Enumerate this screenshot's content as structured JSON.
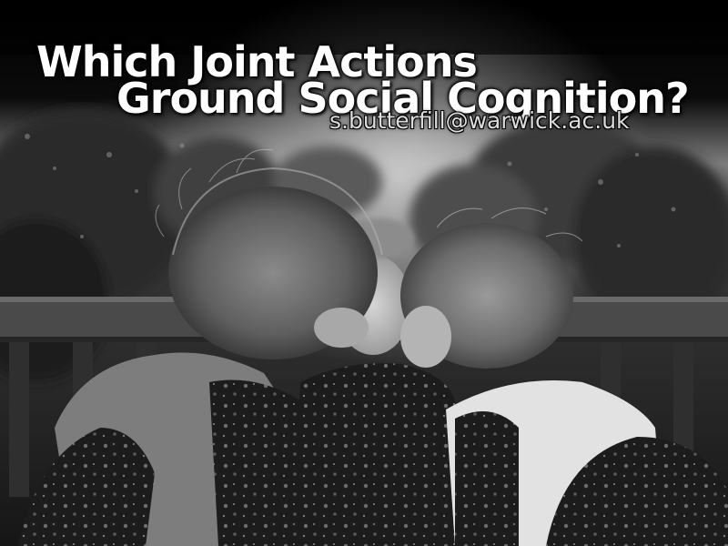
{
  "slide": {
    "title_line_1": "Which Joint Actions",
    "title_line_2": "Ground Social Cognition?",
    "email": "s.butterfill@warwick.ac.uk"
  },
  "photo": {
    "style": "black-and-white",
    "subject": "three-children-on-bench"
  },
  "colors": {
    "title": "#ffffff",
    "email": "#dcdcdc",
    "background_top": "#000000"
  }
}
